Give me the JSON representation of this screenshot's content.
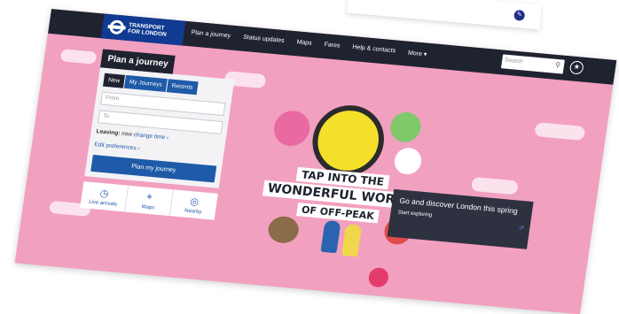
{
  "brand": {
    "line1": "TRANSPORT",
    "line2": "FOR LONDON"
  },
  "nav": [
    "Plan a journey",
    "Status updates",
    "Maps",
    "Fares",
    "Help & contacts",
    "More"
  ],
  "search": {
    "placeholder": "Search"
  },
  "planner": {
    "title": "Plan a journey",
    "tabs": [
      "New",
      "My Journeys",
      "Recents"
    ],
    "from_placeholder": "From",
    "to_placeholder": "To",
    "leaving_label": "Leaving:",
    "leaving_value": "now",
    "change_time": "change time",
    "edit_preferences": "Edit preferences",
    "button": "Plan my journey"
  },
  "quick_links": [
    {
      "label": "Live arrivals",
      "icon": "clock-icon"
    },
    {
      "label": "Maps",
      "icon": "map-icon"
    },
    {
      "label": "Nearby",
      "icon": "nearby-icon"
    }
  ],
  "hero": {
    "line1": "TAP INTO THE",
    "line2": "WONDERFUL WORLD",
    "line3": "OF OFF-PEAK"
  },
  "promo": {
    "title": "Go and discover London this spring",
    "link": "Start exploring"
  },
  "colors": {
    "background": "#f2a0c0",
    "topbar": "#1f2330",
    "tfl_blue": "#113b92",
    "button_blue": "#1f5aa8"
  }
}
